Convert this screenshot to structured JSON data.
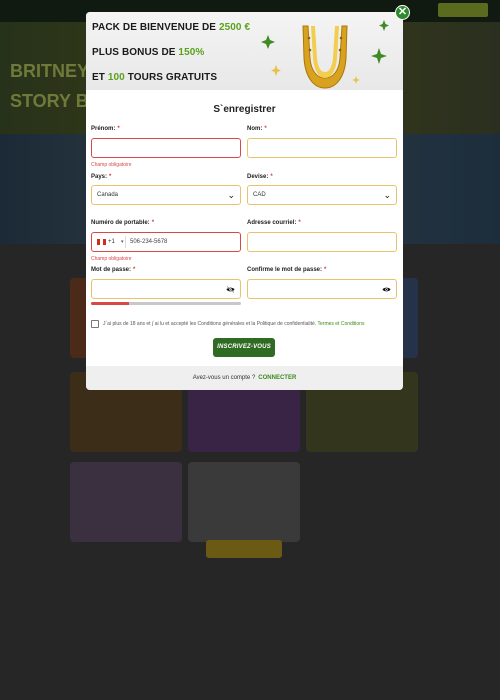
{
  "promo": {
    "line1_prefix": "PACK DE BIENVENUE DE ",
    "line1_highlight": "2500 €",
    "line2_prefix": "PLUS BONUS DE ",
    "line2_highlight": "150%",
    "line3_prefix": "ET ",
    "line3_highlight": "100",
    "line3_suffix": " TOURS GRATUITS"
  },
  "form": {
    "title": "S`enregistrer",
    "first_name_label": "Prénom:",
    "first_name_value": "",
    "first_name_error": "Champ obligatoire",
    "last_name_label": "Nom:",
    "last_name_value": "",
    "country_label": "Pays:",
    "country_value": "Canada",
    "currency_label": "Devise:",
    "currency_value": "CAD",
    "phone_label": "Numéro de portable:",
    "phone_code": "+1",
    "phone_placeholder": "506-234-5678",
    "phone_error": "Champ obligatoire",
    "email_label": "Adresse courriel:",
    "email_value": "",
    "password_label": "Mot de passe:",
    "confirm_label": "Confirme le mot de passe:",
    "password_strength": 0.25,
    "required_mark": "*",
    "terms_text": "J`ai plus de 18 ans et j`ai lu et accepté les Conditions générales et la Politique de confidentialité.",
    "terms_link": "Termes et Conditions",
    "submit_label": "INSCRIVEZ-VOUS"
  },
  "footer": {
    "question": "Avez-vous un compte ?",
    "login_link": "CONNECTER"
  },
  "background": {
    "banner_text_1": "BRITNEY",
    "banner_text_2": "STORY BO"
  },
  "colors": {
    "accent_green": "#5aa21b",
    "button_green": "#2f6b22",
    "error_red": "#d94848",
    "field_border": "#e9c36b"
  }
}
